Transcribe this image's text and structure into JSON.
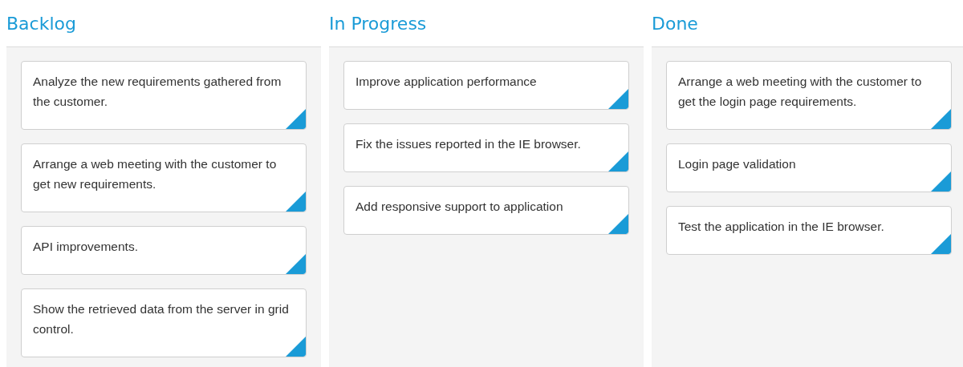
{
  "columns": [
    {
      "title": "Backlog",
      "cards": [
        {
          "text": "Analyze the new requirements gathered from the customer."
        },
        {
          "text": "Arrange a web meeting with the customer to get new requirements."
        },
        {
          "text": "API improvements."
        },
        {
          "text": "Show the retrieved data from the server in grid control."
        }
      ]
    },
    {
      "title": "In Progress",
      "cards": [
        {
          "text": "Improve application performance"
        },
        {
          "text": "Fix the issues reported in the IE browser."
        },
        {
          "text": "Add responsive support to application"
        }
      ]
    },
    {
      "title": "Done",
      "cards": [
        {
          "text": "Arrange a web meeting with the customer to get the login page requirements."
        },
        {
          "text": "Login page validation"
        },
        {
          "text": "Test the application in the IE browser."
        }
      ]
    }
  ]
}
